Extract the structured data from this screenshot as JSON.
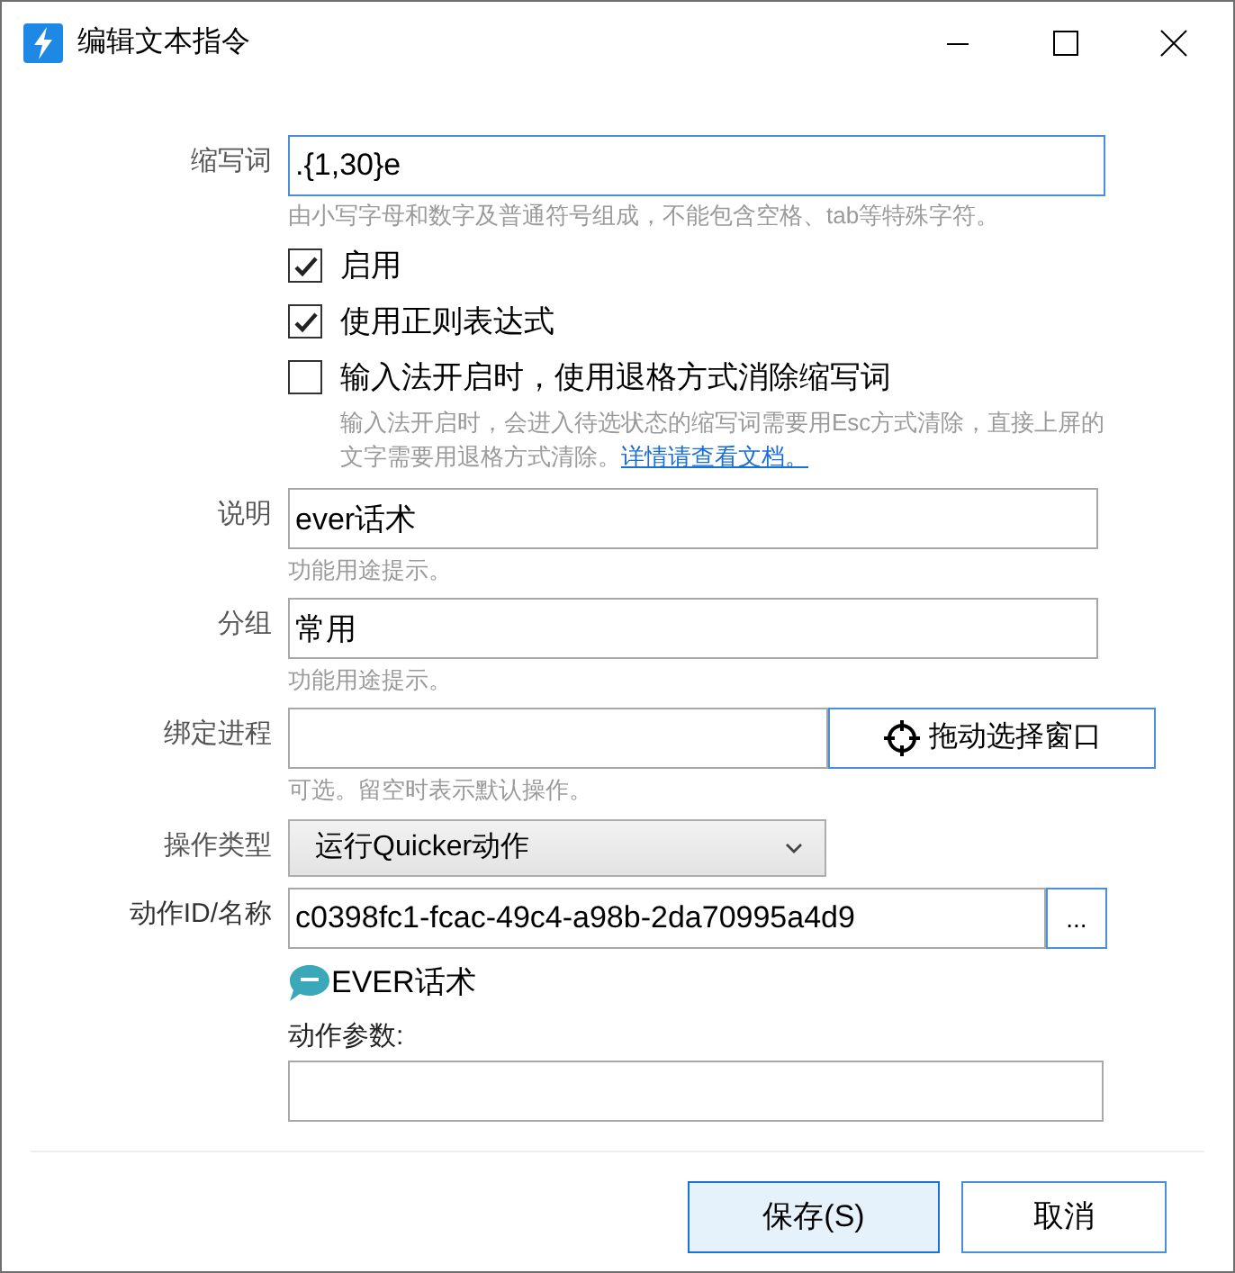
{
  "window": {
    "title": "编辑文本指令"
  },
  "abbreviation": {
    "label": "缩写词",
    "value": ".{1,30}e",
    "hint": "由小写字母和数字及普通符号组成，不能包含空格、tab等特殊字符。"
  },
  "options": [
    {
      "label": "启用",
      "checked": true
    },
    {
      "label": "使用正则表达式",
      "checked": true
    },
    {
      "label": "输入法开启时，使用退格方式消除缩写词",
      "checked": false,
      "hint": "输入法开启时，会进入待选状态的缩写词需要用Esc方式清除，直接上屏的文字需要用退格方式清除。",
      "link": "详情请查看文档。"
    }
  ],
  "description": {
    "label": "说明",
    "value": "ever话术",
    "hint": "功能用途提示。"
  },
  "group": {
    "label": "分组",
    "value": "常用",
    "hint": "功能用途提示。"
  },
  "process": {
    "label": "绑定进程",
    "hint": "可选。留空时表示默认操作。",
    "button": "拖动选择窗口"
  },
  "action_type": {
    "label": "操作类型",
    "value": "运行Quicker动作"
  },
  "action_id": {
    "label": "动作ID/名称",
    "value": "c0398fc1-fcac-49c4-a98b-2da70995a4d9",
    "button": "..."
  },
  "action_name": "EVER话术",
  "action_params": {
    "label": "动作参数:"
  },
  "buttons": [
    {
      "label": "保存(S)",
      "kind": "primary"
    },
    {
      "label": "取消",
      "kind": "secondary"
    }
  ]
}
